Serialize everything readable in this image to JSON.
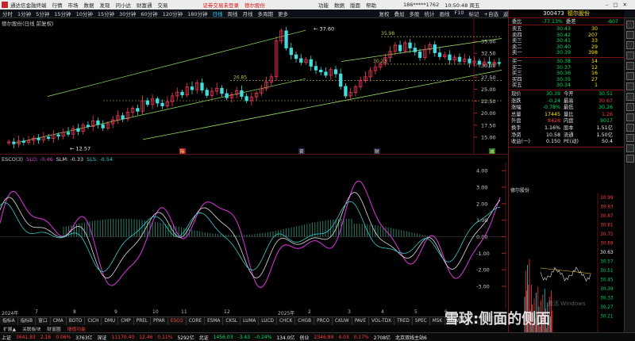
{
  "titlebar": {
    "app": "通达信金融终端",
    "menus": [
      "行情",
      "市场",
      "数据",
      "发现",
      "问小达",
      "财富通",
      "交易"
    ],
    "notice": "证券交易未登录",
    "stock": "德尔股份",
    "right_menus": [
      "功能",
      "数据",
      "版面",
      "帮助"
    ],
    "phone": "186*****1762",
    "time": "10:50:48 周五"
  },
  "periodbar": {
    "items": [
      "分时",
      "1分钟",
      "5分钟",
      "15分钟",
      "10分钟",
      "15分钟",
      "30分钟",
      "60分钟",
      "120分钟",
      "180分钟",
      "日线",
      "周线",
      "月线",
      "多周期",
      "更多"
    ],
    "active": "日线",
    "right_items": [
      "复权",
      "叠加",
      "多股",
      "统计",
      "画线",
      "F10",
      "标记",
      "+自选",
      "返回"
    ]
  },
  "chart": {
    "title": "德尔股份(日线 前复权)",
    "price_ticks": [
      "35.00",
      "32.50",
      "30.00",
      "27.50",
      "25.00",
      "22.50",
      "20.00",
      "17.50",
      "15.00"
    ],
    "annotations": {
      "high": "37.60",
      "low": "12.57",
      "mark1": "35.98",
      "mark2": "30.23",
      "mark3": "26.85"
    },
    "event_tags": [
      "除",
      "资",
      "财",
      "减"
    ],
    "candles": [
      14,
      13.6,
      14.2,
      13.9,
      14.3,
      14.8,
      14.4,
      15,
      14.7,
      15.5,
      15.2,
      16,
      15.6,
      16.8,
      16.2,
      17.5,
      17.2,
      18.4,
      17.6,
      16.9,
      17.8,
      18.6,
      19.5,
      18.8,
      20.2,
      21,
      20.4,
      22.6,
      21.8,
      23,
      22.1,
      21.5,
      22.4,
      23.6,
      24.4,
      23.8,
      25.5,
      24.9,
      26.3,
      24.8,
      23.7,
      24.6,
      25.2,
      24.1,
      23.2,
      23.9,
      24.7,
      23.5,
      22.6,
      23.4,
      24.2,
      25.1,
      26.5,
      27.6,
      35.1,
      37.2,
      33.6,
      32.2,
      31.4,
      30.6,
      31.2,
      29.8,
      29,
      28.6,
      27.9,
      29.1,
      28.2,
      25.6,
      23.6,
      24.3,
      25.5,
      26.8,
      27.6,
      28.9,
      29.6,
      30.3,
      31.6,
      32.9,
      34.2,
      33,
      34.7,
      33.6,
      32.8,
      31.6,
      33.3,
      34.3,
      32.6,
      31.8,
      32.2,
      31.1,
      31.7,
      30.8,
      31.3,
      30.5,
      30.9,
      30.2,
      30.7,
      30.4,
      30.6,
      30.39
    ]
  },
  "indicator": {
    "name": "ESCO(3)",
    "slo": "SLO: -0.46",
    "slm": "SLM: -0.33",
    "sls": "SLS: -0.54",
    "ticks": [
      "4.00",
      "3.00",
      "2.00",
      "1.00",
      "0.00",
      "-1.00",
      "-2.00",
      "-3.00"
    ],
    "months": [
      "2024年",
      "7",
      "8",
      "9",
      "10",
      "11",
      "12",
      "2025年",
      "2",
      "3",
      "4",
      "5",
      "6"
    ]
  },
  "tabs": {
    "items": [
      "指标A",
      "指标B",
      "窗口",
      "CMA",
      "BOTO",
      "CICH",
      "DMU",
      "CMP",
      "PREL",
      "PPAR",
      "ESCO",
      "CORE",
      "ESMA",
      "CKSL",
      "LUMA",
      "LUCD",
      "CHCK",
      "CHGB",
      "PRCO",
      "CKUW",
      "PAVE",
      "VOL-TDX",
      "TRED",
      "SPEC",
      "MSK",
      "POWER"
    ],
    "active": "ESCO",
    "bottom": [
      "扩展▲",
      "关联板块",
      "财富圈",
      "增值功能"
    ]
  },
  "status": {
    "idx1": "上证",
    "v1": "3641.83",
    "c1": "2.16",
    "p1": "0.06%",
    "a1": "3763亿",
    "idx2": "深证",
    "v2": "11170.40",
    "c2": "12.46",
    "p2": "0.11%",
    "a2": "5292亿",
    "idx3": "北证",
    "v3": "1456.03",
    "c3": "-3.43",
    "p3": "-0.24%",
    "a3": "134.0亿",
    "idx4": "创业",
    "v4": "2346.89",
    "c4": "4.03",
    "p4": "0.17%",
    "a4": "2708亿",
    "tail": "北京双线主站6"
  },
  "rp": {
    "code": "300473",
    "name": "德尔股份",
    "ratio_label": "委比",
    "ratio_pct": "-77.13%",
    "ratio_word": "委差",
    "ratio_diff": "-607",
    "sells": [
      {
        "l": "卖五",
        "p": "30.43",
        "v": "30"
      },
      {
        "l": "卖四",
        "p": "30.42",
        "v": "207"
      },
      {
        "l": "卖三",
        "p": "30.41",
        "v": "33"
      },
      {
        "l": "卖二",
        "p": "30.40",
        "v": "29"
      },
      {
        "l": "卖一",
        "p": "30.39",
        "v": "398"
      }
    ],
    "buys": [
      {
        "l": "买一",
        "p": "30.38",
        "v": "14"
      },
      {
        "l": "买二",
        "p": "30.37",
        "v": "12"
      },
      {
        "l": "买三",
        "p": "30.36",
        "v": "16"
      },
      {
        "l": "买四",
        "p": "30.35",
        "v": "27"
      },
      {
        "l": "买五",
        "p": "30.34",
        "v": "1"
      }
    ],
    "quotes": [
      {
        "a": "现价",
        "av": "30.39",
        "b": "今开",
        "bv": "30.51"
      },
      {
        "a": "涨跌",
        "av": "-0.24",
        "b": "最高",
        "bv": "30.67"
      },
      {
        "a": "涨幅",
        "av": "-0.78%",
        "b": "最低",
        "bv": "30.26"
      },
      {
        "a": "总量",
        "av": "17445",
        "b": "量比",
        "bv": "1.26"
      },
      {
        "a": "外盘",
        "av": "8428",
        "b": "内盘",
        "bv": "9017"
      },
      {
        "a": "换手",
        "av": "1.16%",
        "b": "股本",
        "bv": "1.51亿"
      },
      {
        "a": "净资",
        "av": "10.58",
        "b": "流通",
        "bv": "1.50亿"
      },
      {
        "a": "收益(一)",
        "av": "0.150",
        "b": "PE(动)",
        "bv": "50.4"
      }
    ],
    "mini_title": "德尔股份",
    "mini_ticks": [
      "30.99",
      "30.93",
      "30.87",
      "30.81",
      "30.75",
      "30.69",
      "30.63",
      "30.57",
      "30.51",
      "30.45",
      "30.39",
      "30.33",
      "30.27",
      "30.21"
    ]
  },
  "watermark": "雪球:侧面的侧面",
  "windows_text": "激活 Windows"
}
